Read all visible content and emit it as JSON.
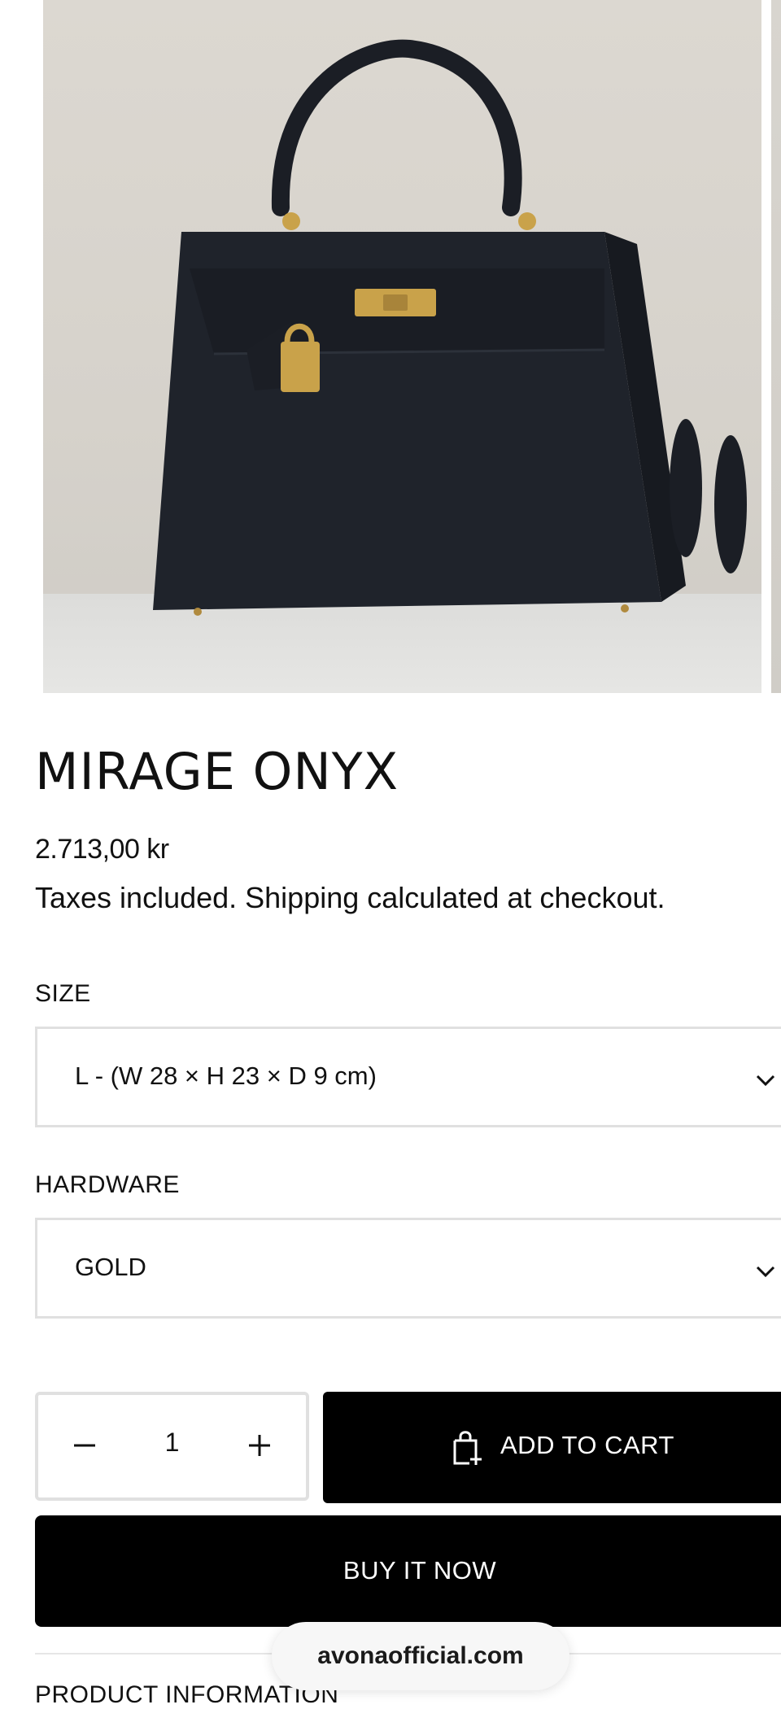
{
  "product": {
    "title": "MIRAGE ONYX",
    "price": "2.713,00 kr",
    "tax_note": "Taxes included. Shipping calculated at checkout."
  },
  "options": {
    "size": {
      "label": "SIZE",
      "value": "L - (W 28 × H 23 × D 9 cm)"
    },
    "hardware": {
      "label": "HARDWARE",
      "value": "GOLD"
    }
  },
  "quantity": {
    "value": "1"
  },
  "actions": {
    "add_to_cart": "ADD TO CART",
    "buy_now": "BUY IT NOW"
  },
  "accordion": {
    "product_information": "PRODUCT INFORMATION"
  },
  "browser": {
    "domain": "avonaofficial.com"
  },
  "colors": {
    "button_bg": "#000000",
    "border": "#e0e0e0",
    "bag": "#1e2128",
    "hardware_gold": "#c9a24a"
  },
  "icons": [
    "chevron-down-icon",
    "minus-icon",
    "plus-icon",
    "cart-add-icon"
  ]
}
